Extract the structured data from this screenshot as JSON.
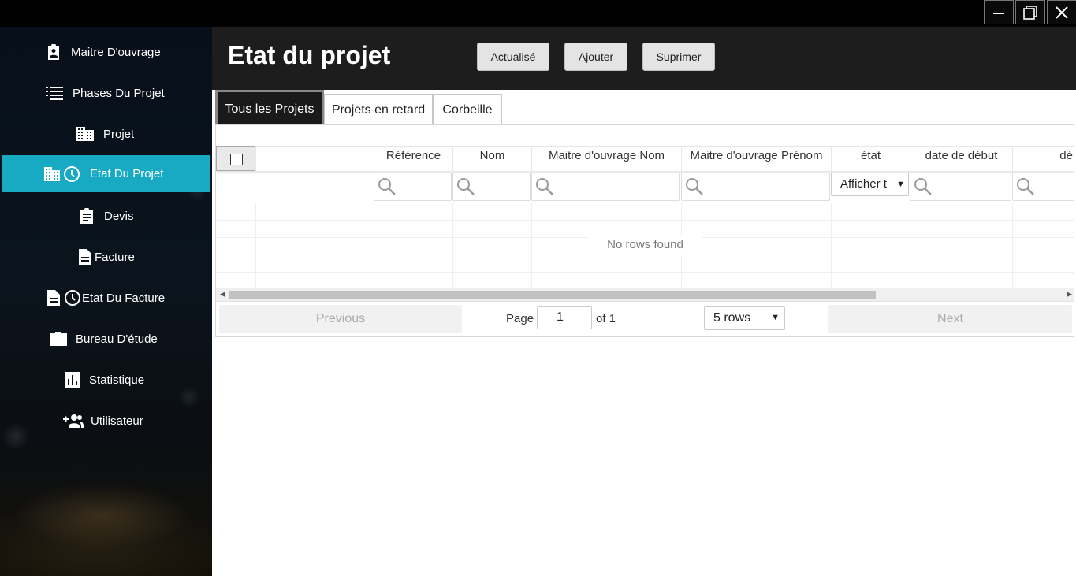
{
  "window": {
    "controls": [
      "minimize-icon",
      "maximize-icon",
      "close-icon"
    ]
  },
  "sidebar": {
    "items": [
      {
        "label": "Maitre D'ouvrage",
        "icon": "client-badge-icon"
      },
      {
        "label": "Phases Du Projet",
        "icon": "list-icon"
      },
      {
        "label": "Projet",
        "icon": "building-icon"
      },
      {
        "label": "Etat Du Projet",
        "icon": "building-clock-icon",
        "active": true
      },
      {
        "label": "Devis",
        "icon": "clipboard-icon"
      },
      {
        "label": "Facture",
        "icon": "document-icon"
      },
      {
        "label": "Etat Du Facture",
        "icon": "document-clock-icon"
      },
      {
        "label": "Bureau D'étude",
        "icon": "briefcase-icon"
      },
      {
        "label": "Statistique",
        "icon": "bar-chart-icon"
      },
      {
        "label": "Utilisateur",
        "icon": "add-user-icon"
      }
    ],
    "active_color": "#18a9c3"
  },
  "header": {
    "title": "Etat du projet",
    "buttons": {
      "refresh": "Actualisé",
      "add": "Ajouter",
      "delete": "Suprimer"
    }
  },
  "tabs": [
    {
      "label": "Tous les Projets",
      "active": true
    },
    {
      "label": "Projets en retard",
      "active": false
    },
    {
      "label": "Corbeille",
      "active": false
    }
  ],
  "table": {
    "columns": [
      "",
      "Référence",
      "Nom",
      "Maitre d'ouvrage Nom",
      "Maitre d'ouvrage Prénom",
      "état",
      "date de début",
      "délai"
    ],
    "state_filter": "Afficher t",
    "empty_message": "No rows found"
  },
  "pagination": {
    "previous": "Previous",
    "next": "Next",
    "page_label": "Page",
    "page": "1",
    "of_label": "of 1",
    "page_size": "5 rows"
  }
}
